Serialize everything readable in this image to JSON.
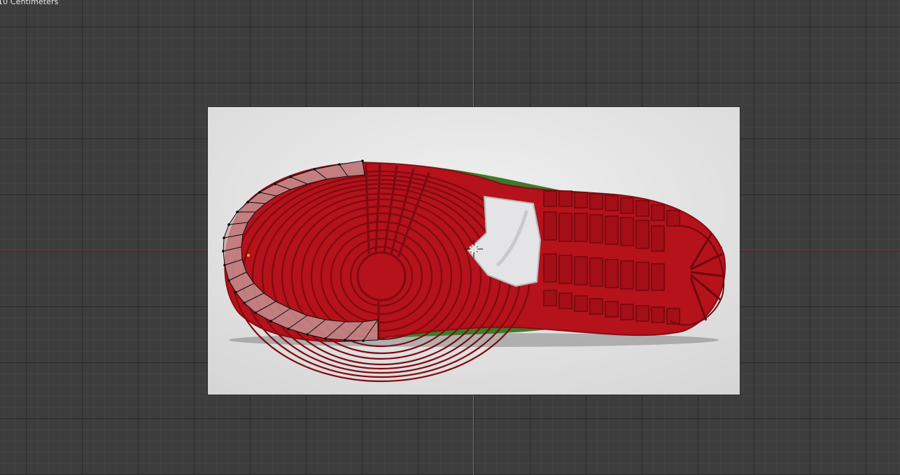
{
  "viewport": {
    "grid_scale_label": "10 Centimeters"
  },
  "reference_image": {
    "subject": "sneaker-outsole",
    "colors": {
      "background": "#e2e2e2",
      "sole_red": "#b5121b",
      "sole_dark_red": "#7e0a10",
      "upper_green": "#3e7a2a",
      "toe_patch": "#e4e4e6"
    }
  },
  "mesh_overlay": {
    "edge_color": "#0a0a0a",
    "face_color": "#c9a3a3",
    "vertex_color": "#000000",
    "active_vertex_color": "#ff9a2e"
  },
  "axes": {
    "x_color": "#8a3a3f",
    "y_color": "#6d8a2a"
  }
}
